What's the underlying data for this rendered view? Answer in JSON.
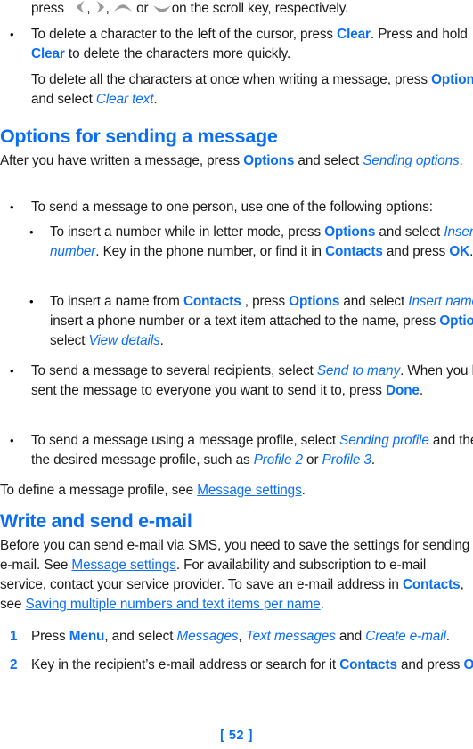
{
  "page": {
    "number_label": "[ 52 ]",
    "accent_color": "#0a6ef5",
    "text_color": "#1a1a1a",
    "glyph_color": "#8c8c8c",
    "background": "#ffffff"
  },
  "blocks": {
    "intro_line": {
      "lead": "press",
      "comma1": ",",
      "comma2": ",",
      "or": "or",
      "tail": "on the scroll key, respectively.",
      "icons": [
        "scroll-left-icon",
        "scroll-right-icon",
        "scroll-up-icon",
        "scroll-down-icon"
      ]
    },
    "bullet_delete_char": {
      "t1": "To delete a character to the left of the cursor, press ",
      "k1": "Clear",
      "t2": ". Press and hold ",
      "k2": "Clear",
      "t3": " to delete the characters more quickly."
    },
    "para_delete_all": {
      "t1": "To delete all the characters at once when writing a message, press ",
      "k1": "Options",
      "t2": " and select ",
      "m1": "Clear text",
      "t3": "."
    },
    "heading_options": "Options for sending a message",
    "para_after_written": {
      "t1": "After you have written a message, press ",
      "k1": "Options",
      "t2": " and select ",
      "m1": "Sending options",
      "t3": "."
    },
    "bullet_one_person": {
      "t1": "To send a message to one person, use one of the following options:"
    },
    "sub_insert_number": {
      "t1": "To insert a number while in letter mode, press ",
      "k1": "Options",
      "t2": " and select ",
      "m1": "Insert number",
      "t3": ".  Key in the phone number, or find it in ",
      "k2": "Contacts",
      "t4": " and press ",
      "k3": "OK",
      "t5": "."
    },
    "sub_insert_name": {
      "t1": "To insert a name from ",
      "k1": "Contacts",
      "t2": " , press ",
      "k2": "Options",
      "t3": " and select ",
      "m1": "Insert name",
      "t4": ". To insert a phone number or a text item attached to the name, press ",
      "k3": "Options",
      "t5": " and select ",
      "m2": "View details",
      "t6": "."
    },
    "bullet_several": {
      "t1": "To send a message to several recipients, select ",
      "m1": "Send to many",
      "t2": ". When you have sent the message to everyone you want to send it to, press ",
      "k1": "Done",
      "t3": "."
    },
    "bullet_profile": {
      "t1": "To send a message using a message profile, select ",
      "m1": "Sending profile",
      "t2": " and then the desired message profile, such as ",
      "m2": "Profile 2",
      "t3": " or ",
      "m3": "Profile 3",
      "t4": "."
    },
    "para_define_profile": {
      "t1": "To define a message profile, see ",
      "lnk1": "Message settings",
      "t2": "."
    },
    "heading_email": "Write and send e-mail",
    "para_before_email": {
      "t1": "Before you can send e-mail via SMS, you need to save the settings for sending e-mail. See ",
      "lnk1": "Message settings",
      "t2": ". For availability and subscription to e-mail service, contact your service provider. To save an e-mail address in ",
      "k1": "Contacts",
      "t3": ", see ",
      "lnk2": "Saving multiple numbers and text items per name",
      "t4": "."
    },
    "step_1": {
      "num": "1",
      "t1": "Press ",
      "k1": "Menu",
      "t2": ", and select ",
      "m1": "Messages",
      "t3": ", ",
      "m2": "Text messages",
      "t4": " and ",
      "m3": "Create e-mail",
      "t5": "."
    },
    "step_2": {
      "num": "2",
      "t1": "Key in the recipient’s e-mail address or search for it ",
      "k1": "Contacts",
      "t2": " and press ",
      "k2": "OK",
      "t3": "."
    },
    "bullet_char": "•"
  }
}
